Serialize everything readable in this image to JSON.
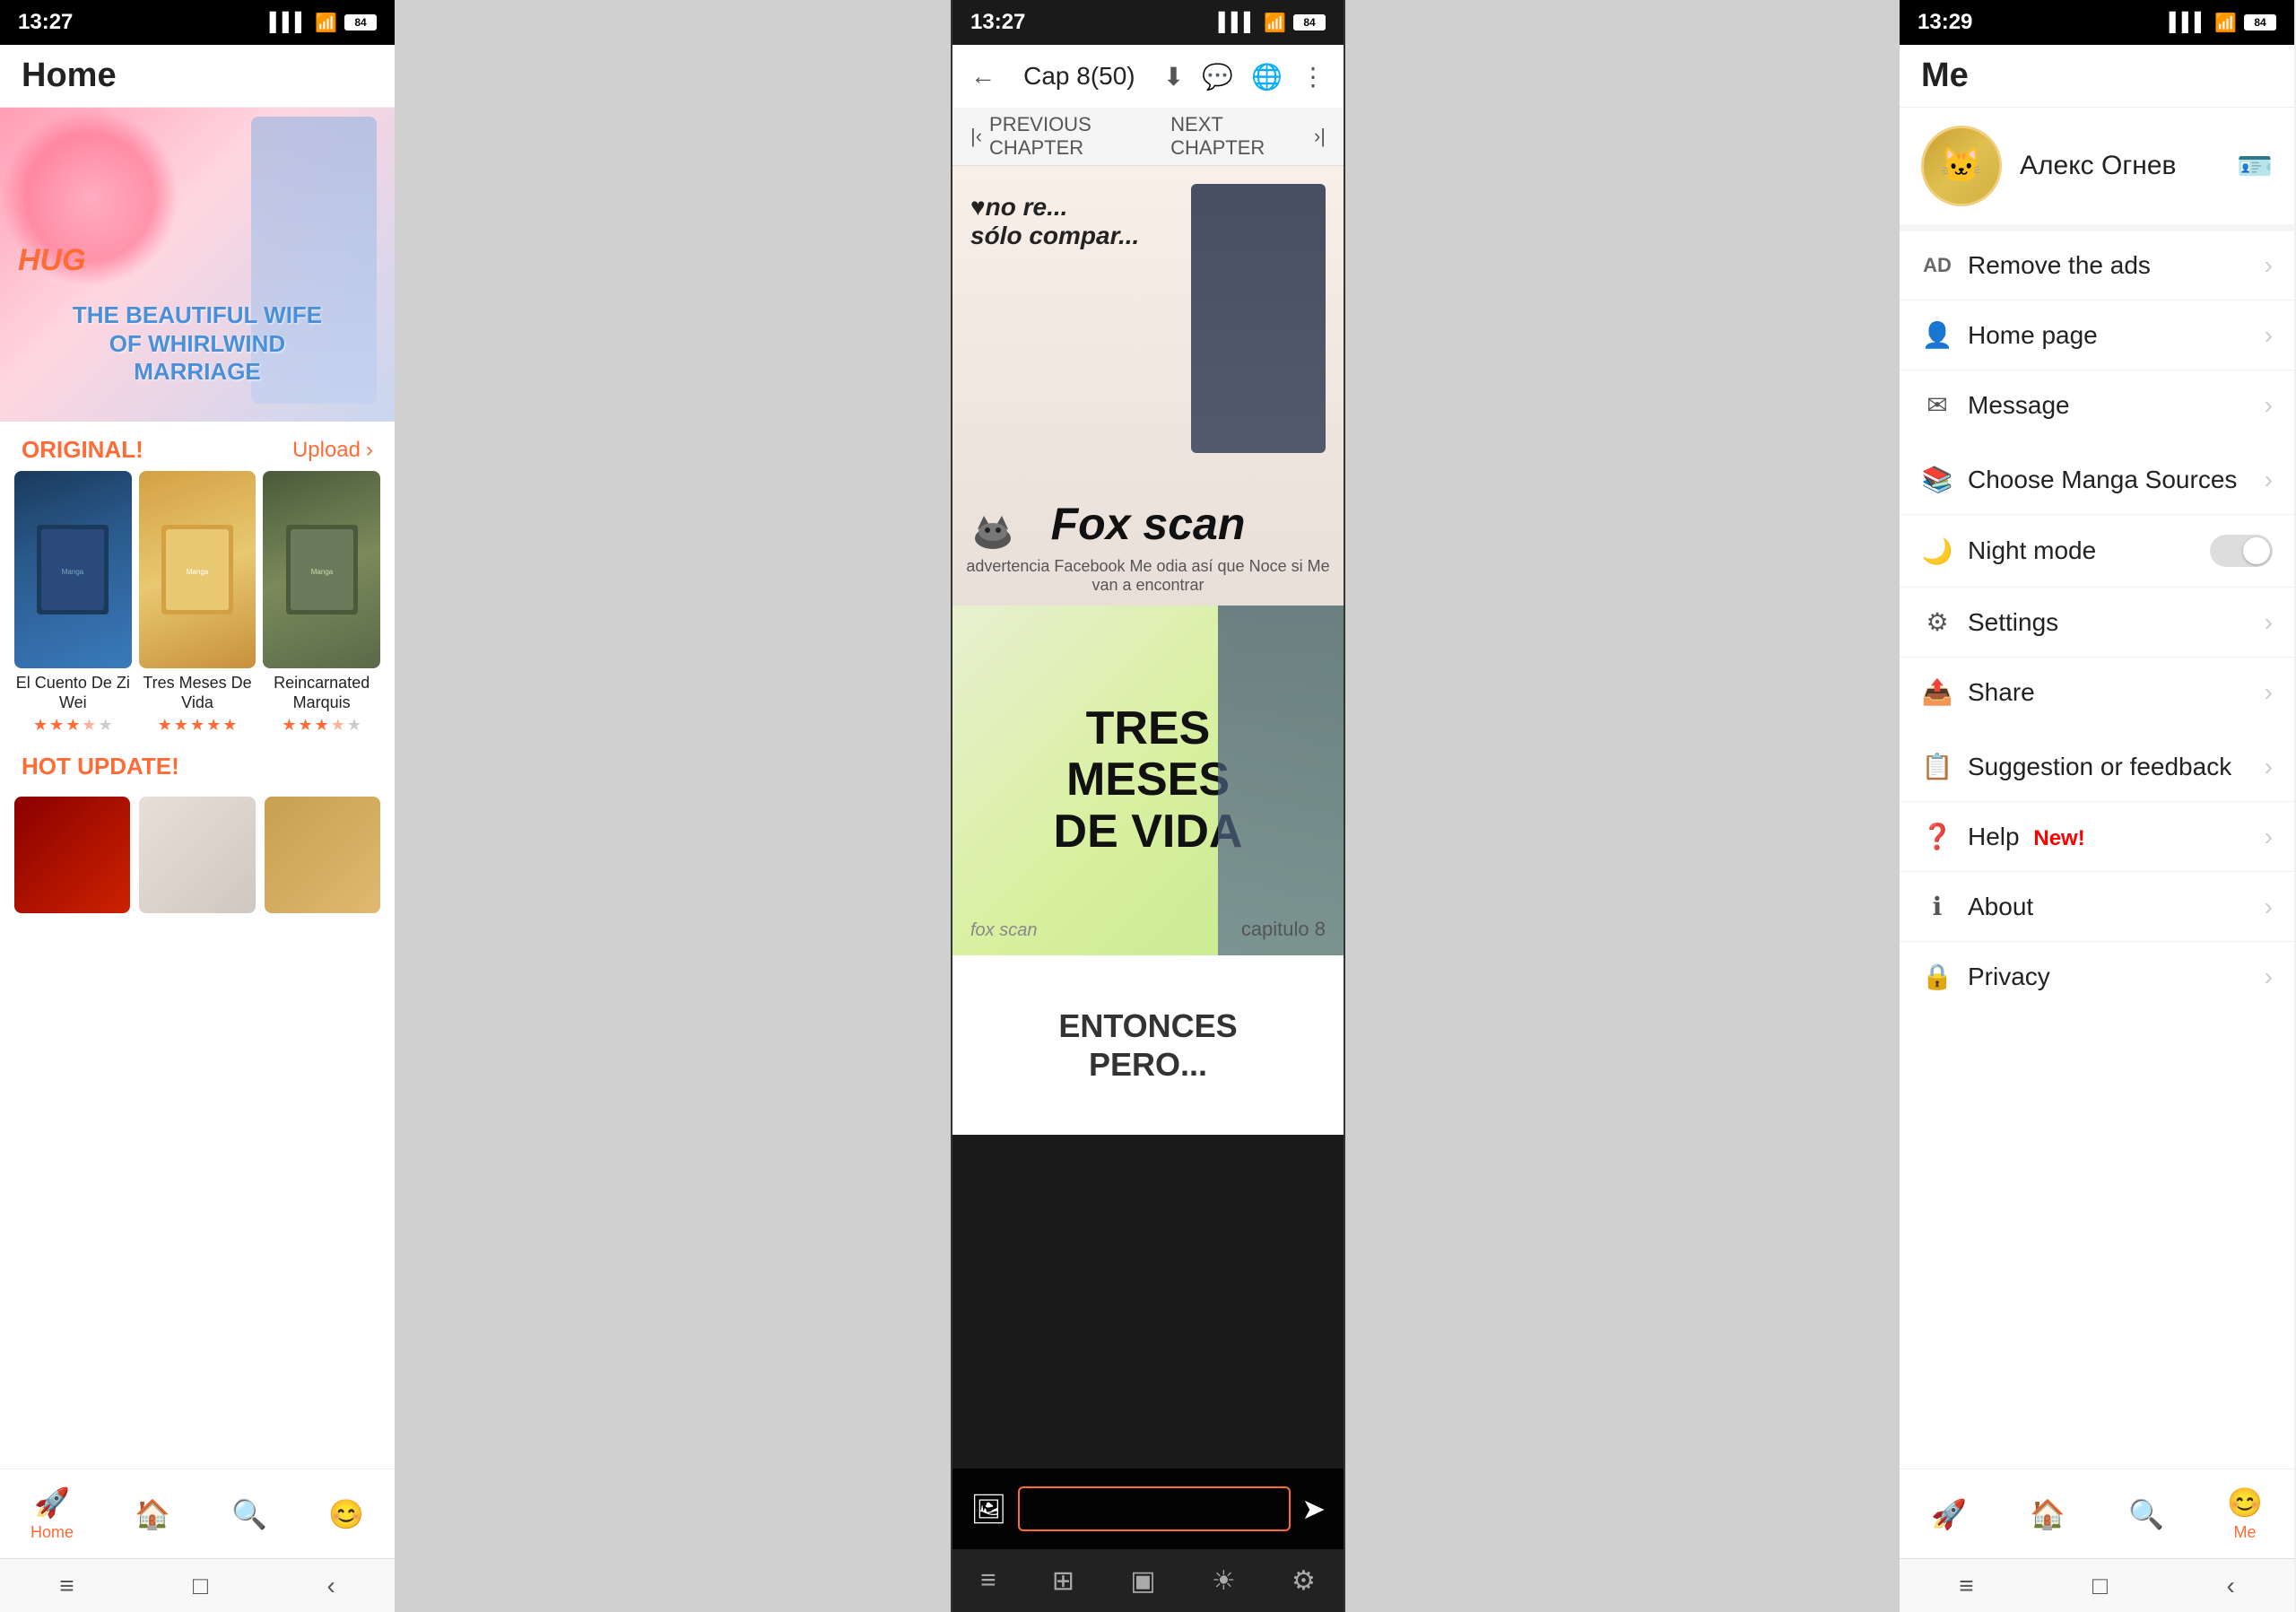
{
  "left_phone": {
    "status_bar": {
      "time": "13:27",
      "battery": "84"
    },
    "header": {
      "title": "Home"
    },
    "banner": {
      "hug_text": "HUG",
      "main_text": "THE BEAUTIFUL WIFE\nOF WHIRLWIND\nMARRIAGE"
    },
    "original_section": {
      "label": "ORIGINAL!",
      "upload": "Upload"
    },
    "manga_list": [
      {
        "name": "El Cuento De Zi Wei",
        "stars": [
          1,
          1,
          1,
          0.5,
          0
        ],
        "cover_style": "1"
      },
      {
        "name": "Tres Meses De Vida",
        "stars": [
          1,
          1,
          1,
          1,
          1
        ],
        "cover_style": "2"
      },
      {
        "name": "Reincarnated Marquis",
        "stars": [
          1,
          1,
          1,
          0.5,
          0
        ],
        "cover_style": "3"
      }
    ],
    "hot_update": {
      "label": "HOT UPDATE!"
    },
    "bottom_nav": [
      {
        "label": "Home",
        "icon": "🚀",
        "active": true
      },
      {
        "label": "",
        "icon": "🏠",
        "active": false
      },
      {
        "label": "",
        "icon": "🔍",
        "active": false
      },
      {
        "label": "",
        "icon": "😊",
        "active": false
      }
    ]
  },
  "middle_phone": {
    "status_bar": {
      "time": "13:27"
    },
    "top_bar": {
      "chapter": "Cap 8(50)",
      "back_icon": "←"
    },
    "chapter_nav": {
      "prev": "PREVIOUS CHAPTER",
      "next": "NEXT CHAPTER"
    },
    "pages": [
      {
        "type": "fox_scan_ad",
        "watermark": "♥no re...\nsólo compar...",
        "brand": "Fox scan",
        "sub_text": "advertencia Facebook Me odia así que Noce si Me van a encontrar"
      },
      {
        "type": "tres_meses",
        "title": "TRES\nMESES\nDE VIDA",
        "chapter_label": "capitulo 8",
        "footer": "fox scan"
      },
      {
        "type": "entonces",
        "text": "ENTONCES\nPERO..."
      }
    ],
    "bottom_bar": {
      "placeholder": ""
    },
    "system_icons": [
      "≡",
      "⊞",
      "▣",
      "☀",
      "⚙"
    ]
  },
  "right_phone": {
    "status_bar": {
      "time": "13:29"
    },
    "header": {
      "title": "Me"
    },
    "profile": {
      "username": "Алекс Огнев",
      "avatar_emoji": "🐱"
    },
    "menu_items": [
      {
        "icon": "AD",
        "icon_type": "text",
        "label": "Remove the ads",
        "type": "arrow"
      },
      {
        "icon": "👤",
        "icon_type": "emoji",
        "label": "Home page",
        "type": "arrow"
      },
      {
        "icon": "✉",
        "icon_type": "emoji",
        "label": "Message",
        "type": "arrow"
      },
      {
        "icon": "📚",
        "icon_type": "emoji",
        "label": "Choose Manga Sources",
        "type": "arrow"
      },
      {
        "icon": "🌙",
        "icon_type": "emoji",
        "label": "Night mode",
        "type": "toggle"
      },
      {
        "icon": "⚙",
        "icon_type": "emoji",
        "label": "Settings",
        "type": "arrow"
      },
      {
        "icon": "📤",
        "icon_type": "emoji",
        "label": "Share",
        "type": "arrow"
      },
      {
        "icon": "📋",
        "icon_type": "emoji",
        "label": "Suggestion or feedback",
        "type": "arrow"
      },
      {
        "icon": "❓",
        "icon_type": "emoji",
        "label": "Help",
        "type": "arrow",
        "badge": "New!"
      },
      {
        "icon": "ℹ",
        "icon_type": "emoji",
        "label": "About",
        "type": "arrow"
      },
      {
        "icon": "🔒",
        "icon_type": "emoji",
        "label": "Privacy",
        "type": "arrow"
      }
    ],
    "bottom_nav": [
      {
        "label": "",
        "icon": "🚀",
        "active": false
      },
      {
        "label": "",
        "icon": "🏠",
        "active": false
      },
      {
        "label": "",
        "icon": "🔍",
        "active": false
      },
      {
        "label": "Me",
        "icon": "😊",
        "active": true
      }
    ]
  }
}
